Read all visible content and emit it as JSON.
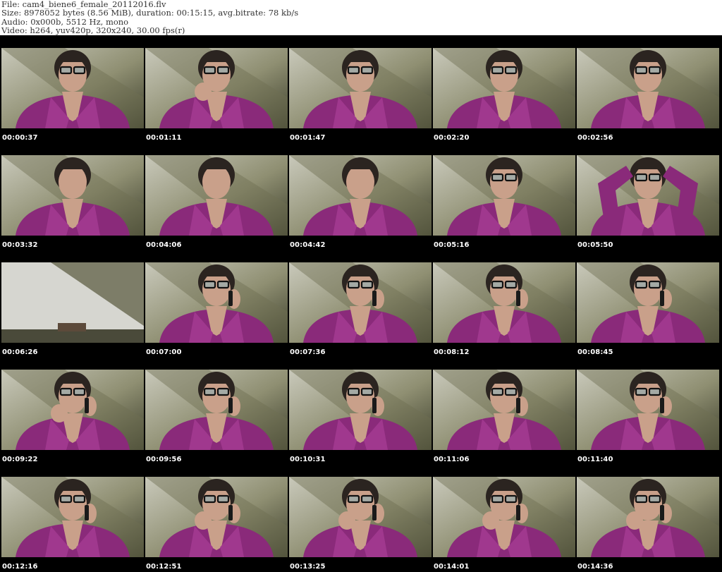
{
  "header": {
    "file_line": "File: cam4_biene6_female_20112016.flv",
    "size_line": "Size: 8978052 bytes (8.56 MiB), duration: 00:15:15, avg.bitrate: 78 kb/s",
    "audio_line": "Audio: 0x000b, 5512 Hz, mono",
    "video_line": "Video: h264, yuv420p, 320x240, 30.00 fps(r)"
  },
  "colors": {
    "background": "#000000",
    "robe": "#8a2a7a",
    "wall": "#b8b8a8"
  },
  "thumbnails": [
    {
      "timestamp": "00:00:37",
      "scene": "person-glasses-robe"
    },
    {
      "timestamp": "00:01:11",
      "scene": "person-glasses-hand-chin"
    },
    {
      "timestamp": "00:01:47",
      "scene": "person-glasses-robe"
    },
    {
      "timestamp": "00:02:20",
      "scene": "person-glasses-robe"
    },
    {
      "timestamp": "00:02:56",
      "scene": "person-glasses-robe"
    },
    {
      "timestamp": "00:03:32",
      "scene": "person-robe"
    },
    {
      "timestamp": "00:04:06",
      "scene": "person-robe"
    },
    {
      "timestamp": "00:04:42",
      "scene": "person-robe"
    },
    {
      "timestamp": "00:05:16",
      "scene": "person-glasses-robe"
    },
    {
      "timestamp": "00:05:50",
      "scene": "person-arms-raised"
    },
    {
      "timestamp": "00:06:26",
      "scene": "empty-room"
    },
    {
      "timestamp": "00:07:00",
      "scene": "person-phone-close"
    },
    {
      "timestamp": "00:07:36",
      "scene": "person-phone-tilted"
    },
    {
      "timestamp": "00:08:12",
      "scene": "person-phone"
    },
    {
      "timestamp": "00:08:45",
      "scene": "person-phone"
    },
    {
      "timestamp": "00:09:22",
      "scene": "person-phone-hand"
    },
    {
      "timestamp": "00:09:56",
      "scene": "person-phone"
    },
    {
      "timestamp": "00:10:31",
      "scene": "person-phone"
    },
    {
      "timestamp": "00:11:06",
      "scene": "person-phone"
    },
    {
      "timestamp": "00:11:40",
      "scene": "person-phone"
    },
    {
      "timestamp": "00:12:16",
      "scene": "person-phone"
    },
    {
      "timestamp": "00:12:51",
      "scene": "person-phone-hand-chin"
    },
    {
      "timestamp": "00:13:25",
      "scene": "person-phone-fist"
    },
    {
      "timestamp": "00:14:01",
      "scene": "person-phone-hand"
    },
    {
      "timestamp": "00:14:36",
      "scene": "person-phone-hand"
    }
  ]
}
